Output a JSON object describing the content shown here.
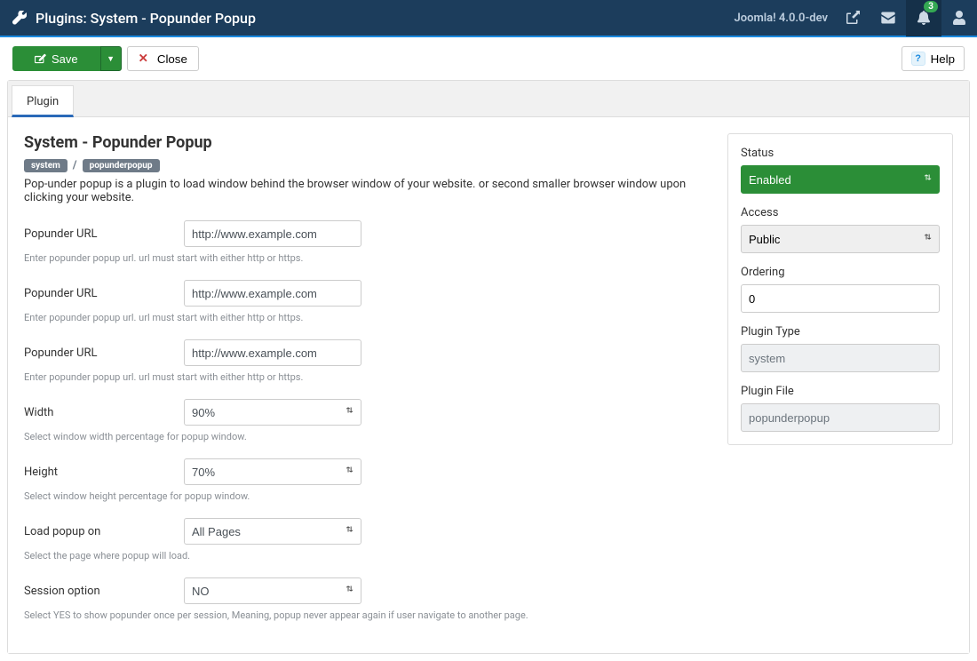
{
  "topbar": {
    "title": "Plugins: System - Popunder Popup",
    "brand": "Joomla! 4.0.0-dev",
    "notifications": "3"
  },
  "toolbar": {
    "save": "Save",
    "close": "Close",
    "help": "Help"
  },
  "tabs": {
    "plugin": "Plugin"
  },
  "page": {
    "heading": "System - Popunder Popup",
    "chip_system": "system",
    "chip_file": "popunderpopup",
    "description": "Pop-under popup is a plugin to load window behind the browser window of your website. or second smaller browser window upon clicking your website."
  },
  "fields": {
    "url1": {
      "label": "Popunder URL",
      "value": "http://www.example.com",
      "hint": "Enter popunder popup url. url must start with either http or https."
    },
    "url2": {
      "label": "Popunder URL",
      "value": "http://www.example.com",
      "hint": "Enter popunder popup url. url must start with either http or https."
    },
    "url3": {
      "label": "Popunder URL",
      "value": "http://www.example.com",
      "hint": "Enter popunder popup url. url must start with either http or https."
    },
    "width": {
      "label": "Width",
      "value": "90%",
      "hint": "Select window width percentage for popup window."
    },
    "height": {
      "label": "Height",
      "value": "70%",
      "hint": "Select window height percentage for popup window."
    },
    "loadon": {
      "label": "Load popup on",
      "value": "All Pages",
      "hint": "Select the page where popup will load."
    },
    "session": {
      "label": "Session option",
      "value": "NO",
      "hint": "Select YES to show popunder once per session, Meaning, popup never appear again if user navigate to another page."
    }
  },
  "sidebar": {
    "status": {
      "label": "Status",
      "value": "Enabled"
    },
    "access": {
      "label": "Access",
      "value": "Public"
    },
    "ordering": {
      "label": "Ordering",
      "value": "0"
    },
    "plugin_type": {
      "label": "Plugin Type",
      "value": "system"
    },
    "plugin_file": {
      "label": "Plugin File",
      "value": "popunderpopup"
    }
  }
}
